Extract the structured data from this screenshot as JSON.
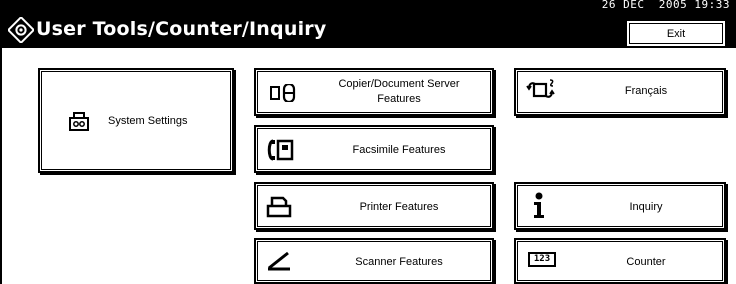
{
  "status": {
    "date": "26 DEC",
    "time": "2005 19:33"
  },
  "header": {
    "title": "User Tools/Counter/Inquiry",
    "exit_label": "Exit"
  },
  "buttons": {
    "system_settings": {
      "label": "System Settings",
      "icon": "system-settings-icon"
    },
    "copier": {
      "label_line1": "Copier/Document Server",
      "label_line2": "Features",
      "icon": "copier-document-server-icon"
    },
    "facsimile": {
      "label": "Facsimile Features",
      "icon": "facsimile-icon"
    },
    "printer": {
      "label": "Printer Features",
      "icon": "printer-icon"
    },
    "scanner": {
      "label": "Scanner Features",
      "icon": "scanner-icon"
    },
    "language": {
      "label": "Français",
      "icon": "language-switch-icon"
    },
    "inquiry": {
      "label": "Inquiry",
      "icon": "information-icon"
    },
    "counter": {
      "label": "Counter",
      "icon": "counter-123-icon",
      "icon_text": "123"
    }
  }
}
